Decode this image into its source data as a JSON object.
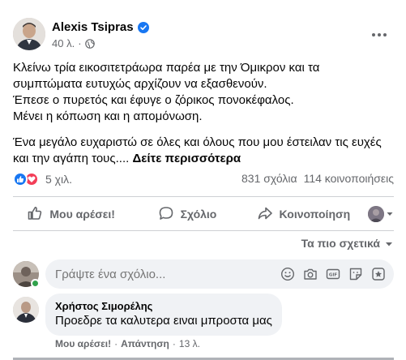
{
  "post": {
    "author": "Alexis Tsipras",
    "verified_icon": "verified-badge-icon",
    "time": "40 λ.",
    "separator": "·",
    "privacy_icon": "globe-icon",
    "more_icon": "more-horizontal-icon",
    "text_lines": [
      "Κλείνω τρία εικοσιτετράωρα παρέα με την Όμικρον και τα",
      "συμπτώματα ευτυχώς αρχίζουν να εξασθενούν.",
      "Έπεσε ο πυρετός και έφυγε ο ζόρικος πονοκέφαλος.",
      "Μένει η κόπωση και η απομόνωση."
    ],
    "text_lines_2": [
      "Ένα μεγάλο ευχαριστώ σε όλες και όλους που μου έστειλαν τις ευχές",
      "και την αγάπη τους...."
    ],
    "see_more": "Δείτε περισσότερα"
  },
  "stats": {
    "reactions_count": "5 χιλ.",
    "comments": "831 σχόλια",
    "shares": "114 κοινοποιήσεις"
  },
  "actions": {
    "like": "Μου αρέσει!",
    "comment": "Σχόλιο",
    "share": "Κοινοποίηση"
  },
  "sort": {
    "label": "Τα πιο σχετικά"
  },
  "composer": {
    "placeholder": "Γράψτε ένα σχόλιο..."
  },
  "comments": [
    {
      "author": "Χρήστος Σιμορέλης",
      "text": "Προεδρε τα καλυτερα ειναι μπροστα μας",
      "like": "Μου αρέσει!",
      "reply": "Απάντηση",
      "time": "13 λ."
    }
  ],
  "colors": {
    "accent": "#1877f2",
    "love": "#f33e58",
    "muted": "#65676b",
    "bubble": "#f0f2f5"
  }
}
